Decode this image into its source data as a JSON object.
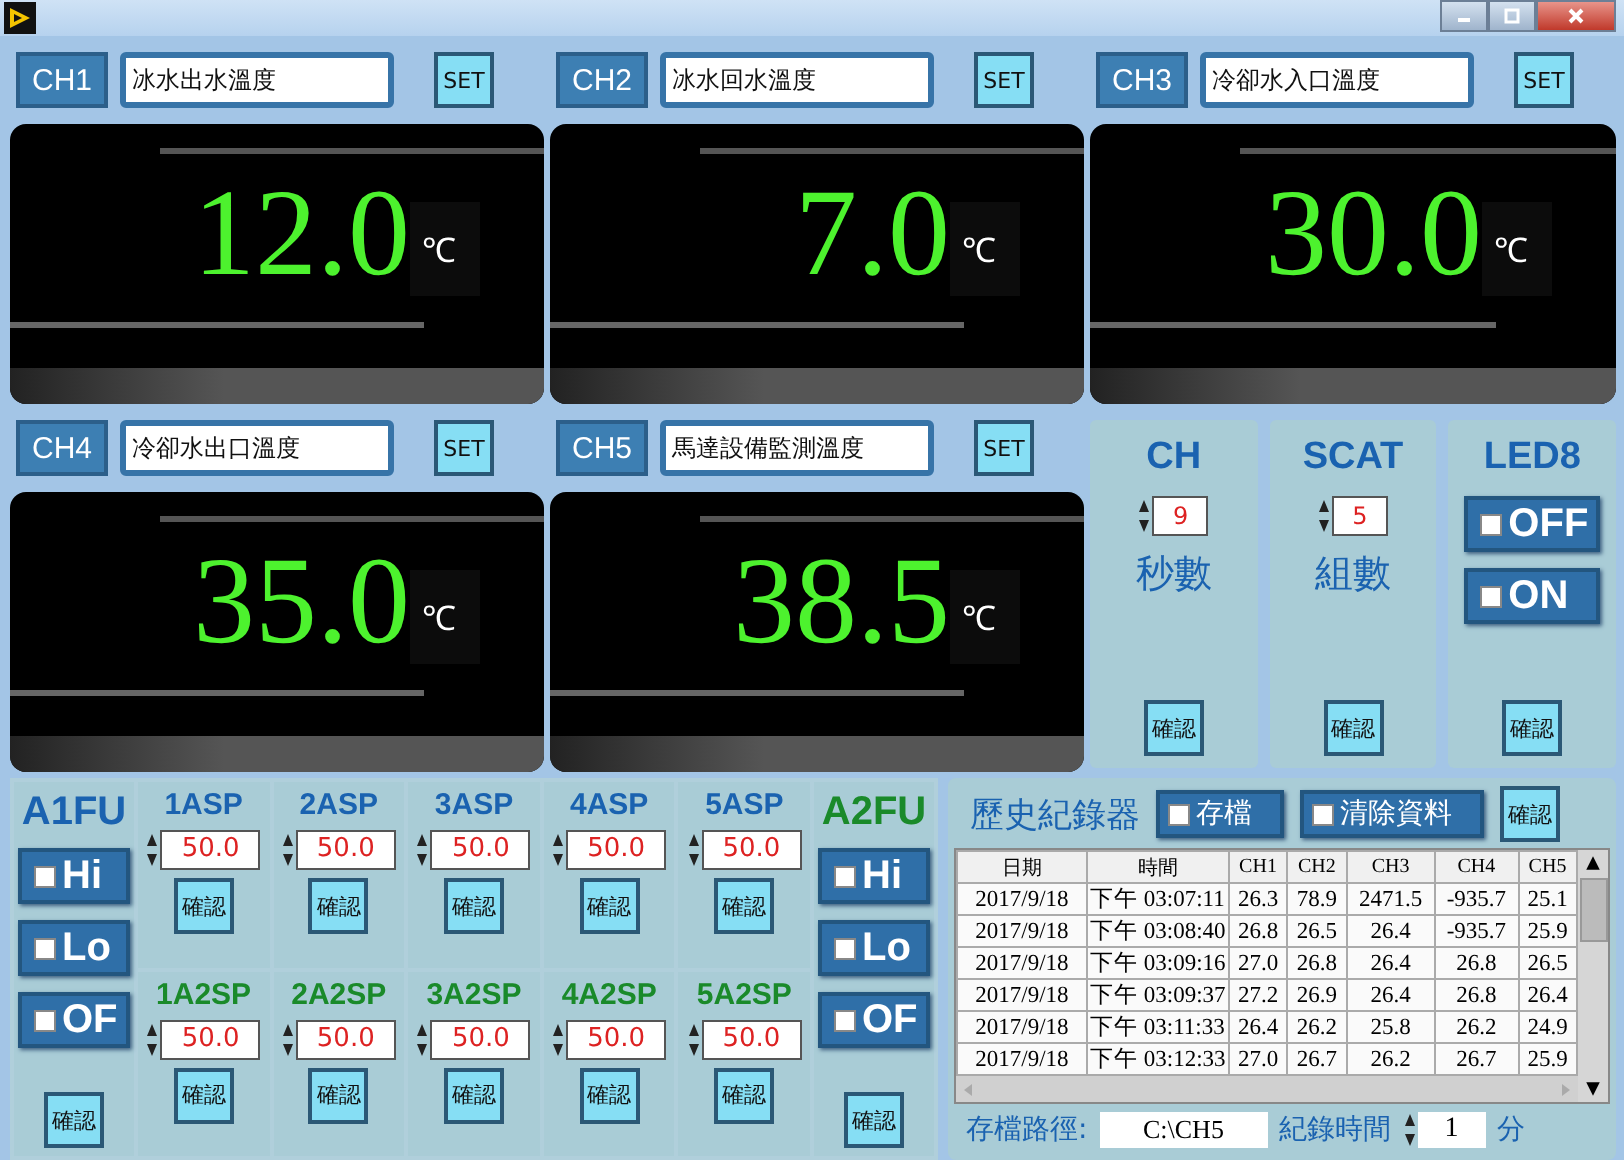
{
  "channels": [
    {
      "label": "CH1",
      "name": "冰水出水溫度",
      "set": "SET",
      "value": "12.0",
      "unit": "℃"
    },
    {
      "label": "CH2",
      "name": "冰水回水溫度",
      "set": "SET",
      "value": "7.0",
      "unit": "℃"
    },
    {
      "label": "CH3",
      "name": "冷卻水入口溫度",
      "set": "SET",
      "value": "30.0",
      "unit": "℃"
    },
    {
      "label": "CH4",
      "name": "冷卻水出口溫度",
      "set": "SET",
      "value": "35.0",
      "unit": "℃"
    },
    {
      "label": "CH5",
      "name": "馬達設備監測溫度",
      "set": "SET",
      "value": "38.5",
      "unit": "℃"
    }
  ],
  "settings": [
    {
      "kind": "spin",
      "title": "CH",
      "value": "9",
      "caption": "秒數",
      "confirm": "確認"
    },
    {
      "kind": "spin",
      "title": "SCAT",
      "value": "5",
      "caption": "組數",
      "confirm": "確認"
    },
    {
      "kind": "toggles",
      "title": "LED8",
      "toggles": [
        {
          "label": "OFF",
          "checked": false
        },
        {
          "label": "ON",
          "checked": false
        }
      ],
      "confirm": "確認"
    }
  ],
  "fu_panels": [
    {
      "title": "A1FU",
      "color": "#1a62b0",
      "toggles": [
        {
          "label": "Hi",
          "checked": false
        },
        {
          "label": "Lo",
          "checked": false
        },
        {
          "label": "OF",
          "checked": false
        }
      ],
      "confirm": "確認"
    },
    {
      "title": "A2FU",
      "color": "#1a8a2a",
      "toggles": [
        {
          "label": "Hi",
          "checked": false
        },
        {
          "label": "Lo",
          "checked": false
        },
        {
          "label": "OF",
          "checked": false
        }
      ],
      "confirm": "確認"
    }
  ],
  "setpoint_rows": [
    {
      "color": "#1a62b0",
      "items": [
        {
          "label": "1ASP",
          "value": "50.0",
          "confirm": "確認"
        },
        {
          "label": "2ASP",
          "value": "50.0",
          "confirm": "確認"
        },
        {
          "label": "3ASP",
          "value": "50.0",
          "confirm": "確認"
        },
        {
          "label": "4ASP",
          "value": "50.0",
          "confirm": "確認"
        },
        {
          "label": "5ASP",
          "value": "50.0",
          "confirm": "確認"
        }
      ]
    },
    {
      "color": "#1a8a2a",
      "items": [
        {
          "label": "1A2SP",
          "value": "50.0",
          "confirm": "確認"
        },
        {
          "label": "2A2SP",
          "value": "50.0",
          "confirm": "確認"
        },
        {
          "label": "3A2SP",
          "value": "50.0",
          "confirm": "確認"
        },
        {
          "label": "4A2SP",
          "value": "50.0",
          "confirm": "確認"
        },
        {
          "label": "5A2SP",
          "value": "50.0",
          "confirm": "確認"
        }
      ]
    }
  ],
  "history": {
    "title": "歷史紀錄器",
    "save": {
      "label": "存檔",
      "checked": false
    },
    "clear": {
      "label": "清除資料",
      "checked": false
    },
    "confirm": "確認",
    "columns": [
      "日期",
      "時間",
      "CH1",
      "CH2",
      "CH3",
      "CH4",
      "CH5"
    ],
    "rows": [
      [
        "2017/9/18",
        "下午 03:07:11",
        "26.3",
        "78.9",
        "2471.5",
        "-935.7",
        "25.1"
      ],
      [
        "2017/9/18",
        "下午 03:08:40",
        "26.8",
        "26.5",
        "26.4",
        "-935.7",
        "25.9"
      ],
      [
        "2017/9/18",
        "下午 03:09:16",
        "27.0",
        "26.8",
        "26.4",
        "26.8",
        "26.5"
      ],
      [
        "2017/9/18",
        "下午 03:09:37",
        "27.2",
        "26.9",
        "26.4",
        "26.8",
        "26.4"
      ],
      [
        "2017/9/18",
        "下午 03:11:33",
        "26.4",
        "26.2",
        "25.8",
        "26.2",
        "24.9"
      ],
      [
        "2017/9/18",
        "下午 03:12:33",
        "27.0",
        "26.7",
        "26.2",
        "26.7",
        "25.9"
      ]
    ],
    "path_label": "存檔路徑:",
    "path": "C:\\CH5",
    "interval_label": "紀錄時間",
    "interval": "1",
    "interval_unit": "分"
  }
}
